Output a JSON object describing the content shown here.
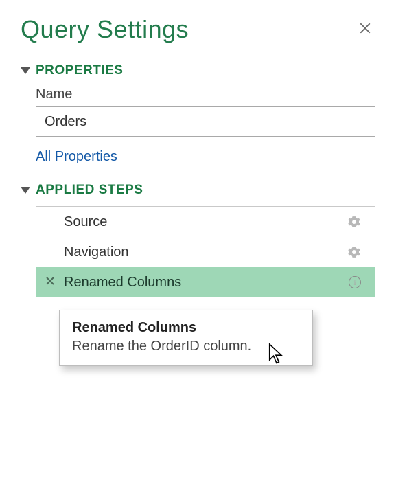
{
  "header": {
    "title": "Query Settings"
  },
  "properties": {
    "section_label": "PROPERTIES",
    "name_label": "Name",
    "name_value": "Orders",
    "all_props_link": "All Properties"
  },
  "steps": {
    "section_label": "APPLIED STEPS",
    "items": [
      {
        "label": "Source",
        "selected": false,
        "has_gear": true,
        "has_info": false
      },
      {
        "label": "Navigation",
        "selected": false,
        "has_gear": true,
        "has_info": false
      },
      {
        "label": "Renamed Columns",
        "selected": true,
        "has_gear": false,
        "has_info": true
      }
    ]
  },
  "tooltip": {
    "title": "Renamed Columns",
    "body": "Rename the OrderID column."
  }
}
